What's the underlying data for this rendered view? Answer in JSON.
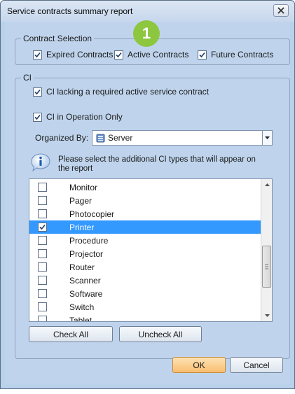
{
  "window": {
    "title": "Service contracts summary report"
  },
  "badge": "1",
  "contract_selection": {
    "label": "Contract Selection",
    "options": [
      {
        "label": "Expired Contracts",
        "checked": true
      },
      {
        "label": "Active Contracts",
        "checked": true
      },
      {
        "label": "Future Contracts",
        "checked": true
      }
    ]
  },
  "ci": {
    "label": "CI",
    "lacking_label": "CI lacking a required active service contract",
    "lacking_checked": true,
    "operation_label": "CI in Operation Only",
    "operation_checked": true,
    "organized_by_label": "Organized By:",
    "organized_by_value": "Server",
    "info_text": "Please select the additional CI types that will appear on the report",
    "types": [
      {
        "label": "Monitor",
        "checked": false,
        "selected": false
      },
      {
        "label": "Pager",
        "checked": false,
        "selected": false
      },
      {
        "label": "Photocopier",
        "checked": false,
        "selected": false
      },
      {
        "label": "Printer",
        "checked": true,
        "selected": true
      },
      {
        "label": "Procedure",
        "checked": false,
        "selected": false
      },
      {
        "label": "Projector",
        "checked": false,
        "selected": false
      },
      {
        "label": "Router",
        "checked": false,
        "selected": false
      },
      {
        "label": "Scanner",
        "checked": false,
        "selected": false
      },
      {
        "label": "Software",
        "checked": false,
        "selected": false
      },
      {
        "label": "Switch",
        "checked": false,
        "selected": false
      },
      {
        "label": "Tablet",
        "checked": false,
        "selected": false
      }
    ],
    "check_all_label": "Check All",
    "uncheck_all_label": "Uncheck All"
  },
  "footer": {
    "ok_label": "OK",
    "cancel_label": "Cancel"
  },
  "colors": {
    "selection": "#3399ff",
    "ok_button": "#f9be6e",
    "badge": "#8dc63f"
  }
}
